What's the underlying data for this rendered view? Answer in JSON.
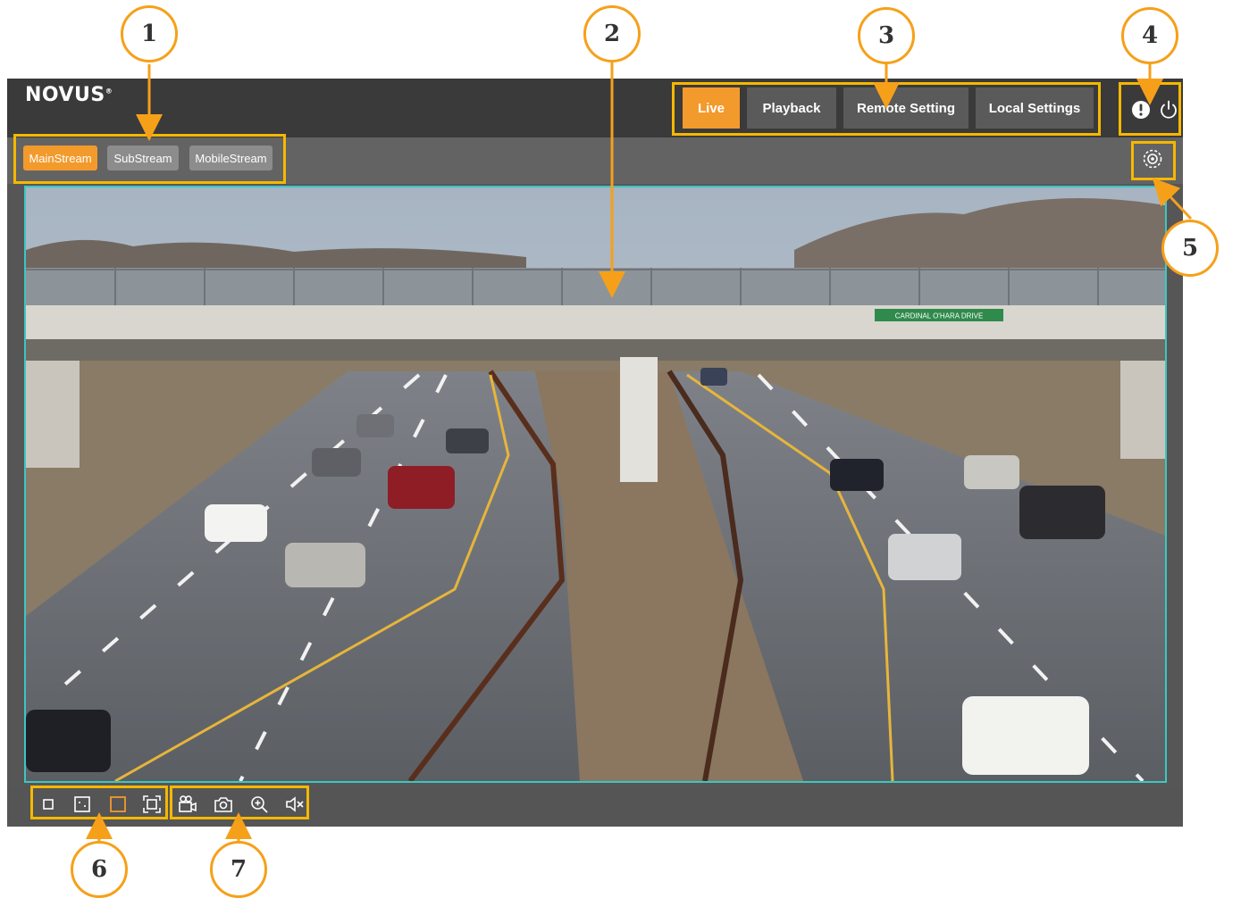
{
  "brand": {
    "logo": "NOVUS"
  },
  "nav": {
    "items": [
      {
        "label": "Live",
        "active": true
      },
      {
        "label": "Playback",
        "active": false
      },
      {
        "label": "Remote Setting",
        "active": false
      },
      {
        "label": "Local Settings",
        "active": false
      }
    ]
  },
  "header_icons": [
    "alarm-exclamation-icon",
    "power-icon"
  ],
  "streams": {
    "items": [
      {
        "label": "MainStream",
        "active": true
      },
      {
        "label": "SubStream",
        "active": false
      },
      {
        "label": "MobileStream",
        "active": false
      }
    ]
  },
  "video": {
    "overpass_sign": "CARDINAL O'HARA DRIVE"
  },
  "toolbar": {
    "view_modes": [
      "original-size-icon",
      "fit-icon",
      "stretch-icon",
      "fullscreen-icon"
    ],
    "active_view_mode": "stretch-icon",
    "actions": [
      "record-icon",
      "snapshot-icon",
      "digital-zoom-icon",
      "audio-muted-icon"
    ]
  },
  "annotations": [
    "1",
    "2",
    "3",
    "4",
    "5",
    "6",
    "7"
  ],
  "colors": {
    "accent": "#f39a2c",
    "callout": "#f5b800",
    "video_border": "#3cc6c2",
    "header": "#3a3a3a"
  }
}
